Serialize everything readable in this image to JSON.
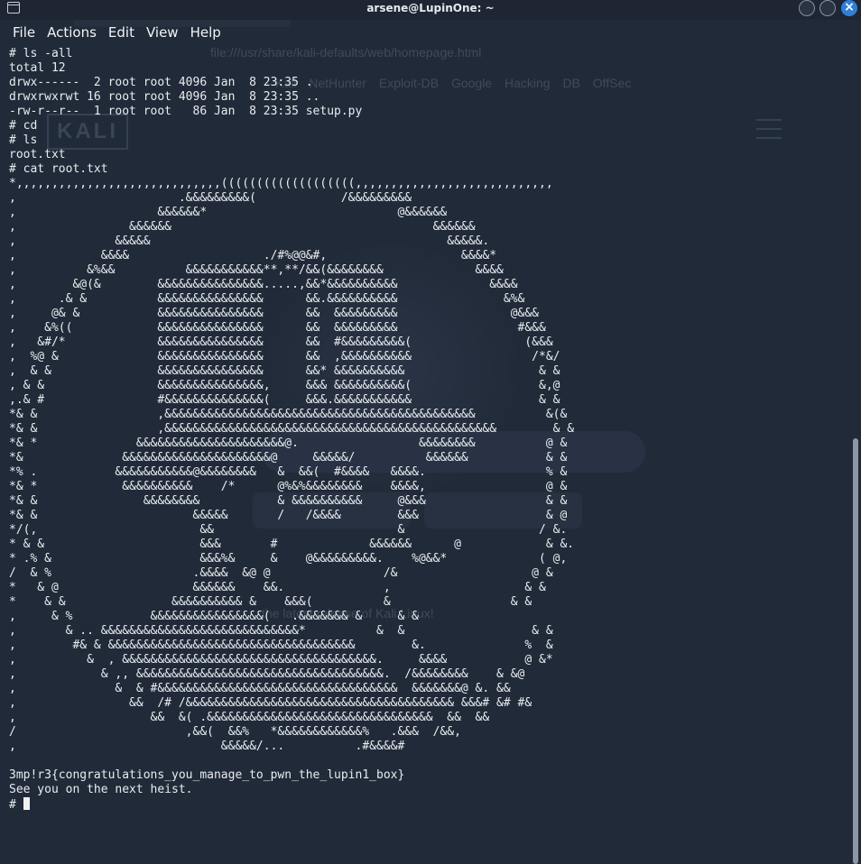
{
  "window": {
    "title": "arsene@LupinOne: ~",
    "icon": "terminal-icon",
    "buttons": {
      "minimize": "minimize-icon",
      "maximize": "maximize-icon",
      "close": "×"
    }
  },
  "menu": [
    "File",
    "Actions",
    "Edit",
    "View",
    "Help"
  ],
  "background": {
    "url": "file:///usr/share/kali-defaults/web/homepage.html",
    "bookmarks": "Kali NetHunter   Exploit-DB   Google Hacking DB   OffSec",
    "logo": "KALI",
    "tagline": "the latest release of Kali Linux!"
  },
  "terminal": {
    "lines": [
      "# ls -all",
      "total 12",
      "drwx------  2 root root 4096 Jan  8 23:35 .",
      "drwxrwxrwt 16 root root 4096 Jan  8 23:35 ..",
      "-rw-r--r--  1 root root   86 Jan  8 23:35 setup.py",
      "# cd",
      "# ls",
      "root.txt",
      "# cat root.txt",
      "*,,,,,,,,,,,,,,,,,,,,,,,,,,,,,(((((((((((((((((((,,,,,,,,,,,,,,,,,,,,,,,,,,,,",
      ",                       .&&&&&&&&&(            /&&&&&&&&&",
      ",                    &&&&&&*                           @&&&&&&",
      ",                &&&&&&                                     &&&&&&",
      ",              &&&&&                                          &&&&&.",
      ",            &&&&                   ./#%@@&#,                   &&&&*",
      ",          &%&&          &&&&&&&&&&&**,**/&&(&&&&&&&&             &&&&",
      ",        &@(&        &&&&&&&&&&&&&&&.....,&&*&&&&&&&&&&             &&&&",
      ",      .& &          &&&&&&&&&&&&&&&      &&.&&&&&&&&&&               &%&",
      ",     @& &           &&&&&&&&&&&&&&&      &&  &&&&&&&&&                @&&&",
      ",    &%((            &&&&&&&&&&&&&&&      &&  &&&&&&&&&                 #&&&",
      ",   &#/*             &&&&&&&&&&&&&&&      &&  #&&&&&&&&&(                (&&&",
      ",  %@ &              &&&&&&&&&&&&&&&      &&  ,&&&&&&&&&&                 /*&/",
      ",  & &               &&&&&&&&&&&&&&&      &&* &&&&&&&&&&                   & &",
      ", & &                &&&&&&&&&&&&&&&,     &&& &&&&&&&&&&(                  &,@",
      ",.& #                #&&&&&&&&&&&&&&(     &&&.&&&&&&&&&&&                  & &",
      "*& &                 ,&&&&&&&&&&&&&&&&&&&&&&&&&&&&&&&&&&&&&&&&&&&&          &(&",
      "*& &                 ,&&&&&&&&&&&&&&&&&&&&&&&&&&&&&&&&&&&&&&&&&&&&&&&        & &",
      "*& *              &&&&&&&&&&&&&&&&&&&&&@.                 &&&&&&&&          @ &",
      "*&              &&&&&&&&&&&&&&&&&&&&&@     &&&&&/          &&&&&&           & &",
      "*% .           &&&&&&&&&&&@&&&&&&&&   &  &&(  #&&&&   &&&&.                 % &",
      "*& *            &&&&&&&&&&    /*      @%&%&&&&&&&&    &&&&,                 @ &",
      "*& &               &&&&&&&&           & &&&&&&&&&&     @&&&                 & &",
      "*& &                      &&&&&       /   /&&&&        &&&                  & @",
      "*/(,                       &&                          &                   / &.",
      "* & &                      &&&       #             &&&&&&      @            & &.",
      "* .% &                     &&&%&     &    @&&&&&&&&&.    %@&&*             ( @,",
      "/  & %                    .&&&&  &@ @                /&                   @ &",
      "*   & @                   &&&&&&    &&.              ,                   & &",
      "*    & &               &&&&&&&&&& &    &&&(          &                 & &",
      ",     & %           &&&&&&&&&&&&&&&&(   .&&&&&&& &     & &",
      ",       & .. &&&&&&&&&&&&&&&&&&&&&&&&&&&&*          &  &                  & &",
      ",        #& & &&&&&&&&&&&&&&&&&&&&&&&&&&&&&&&&&&&        &.              %  &",
      ",          &  , &&&&&&&&&&&&&&&&&&&&&&&&&&&&&&&&&&&&.     &&&&           @ &*",
      ",            & ,, &&&&&&&&&&&&&&&&&&&&&&&&&&&&&&&&&&&.  /&&&&&&&&    & &@",
      ",              &  & #&&&&&&&&&&&&&&&&&&&&&&&&&&&&&&&&&&  &&&&&&&@ &. &&",
      ",                &&  /# /&&&&&&&&&&&&&&&&&&&&&&&&&&&&&&&&&&&&&& &&&# &# #&",
      ",                   &&  &( .&&&&&&&&&&&&&&&&&&&&&&&&&&&&&&&&  &&  &&",
      "/                        ,&&(  &&%   *&&&&&&&&&&&&%   .&&&  /&&,",
      ",                             &&&&&/...          .#&&&&#",
      "",
      "3mp!r3{congratulations_you_manage_to_pwn_the_lupin1_box}",
      "See you on the next heist."
    ],
    "prompt": "# "
  },
  "colors": {
    "background": "#212a38",
    "text": "#e9ecf0",
    "close_button": "#2f7fd8"
  }
}
